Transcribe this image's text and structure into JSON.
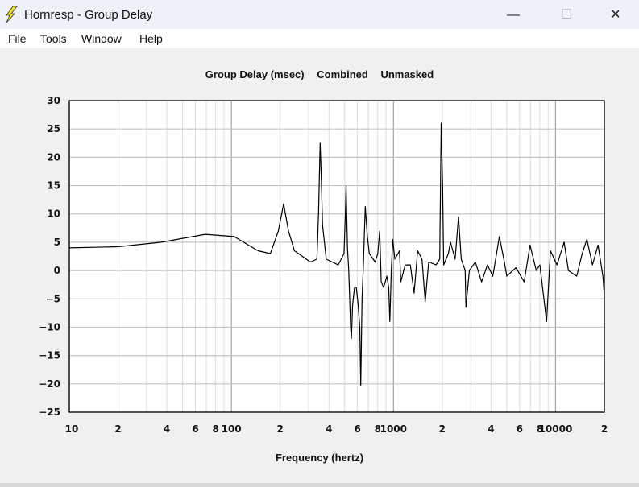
{
  "window": {
    "title": "Hornresp - Group Delay",
    "icon": "lightning-bolt-icon",
    "minimize": "—",
    "maximize": "☐",
    "close": "✕"
  },
  "menu": [
    "File",
    "Tools",
    "Window",
    "Help"
  ],
  "chart_header": [
    "Group Delay (msec)",
    "Combined",
    "Unmasked"
  ],
  "chart_data": {
    "type": "line",
    "title": "Group Delay (msec)   Combined   Unmasked",
    "xlabel": "Frequency (hertz)",
    "ylabel": "",
    "xscale": "log",
    "xlim": [
      10,
      20000
    ],
    "ylim": [
      -25,
      30
    ],
    "grid": true,
    "yticks": [
      30,
      25,
      20,
      15,
      10,
      5,
      0,
      -5,
      -10,
      -15,
      -20,
      -25
    ],
    "xtick_labels": [
      {
        "f": 10,
        "label": "10"
      },
      {
        "f": 20,
        "label": "2"
      },
      {
        "f": 40,
        "label": "4"
      },
      {
        "f": 60,
        "label": "6"
      },
      {
        "f": 80,
        "label": "8"
      },
      {
        "f": 100,
        "label": "100"
      },
      {
        "f": 200,
        "label": "2"
      },
      {
        "f": 400,
        "label": "4"
      },
      {
        "f": 600,
        "label": "6"
      },
      {
        "f": 800,
        "label": "8"
      },
      {
        "f": 1000,
        "label": "1000"
      },
      {
        "f": 2000,
        "label": "2"
      },
      {
        "f": 4000,
        "label": "4"
      },
      {
        "f": 6000,
        "label": "6"
      },
      {
        "f": 8000,
        "label": "8"
      },
      {
        "f": 10000,
        "label": "10000"
      },
      {
        "f": 20000,
        "label": "2"
      }
    ],
    "line_color": "#000000",
    "points": [
      [
        10,
        4.0
      ],
      [
        20,
        4.2
      ],
      [
        37,
        5.0
      ],
      [
        69,
        6.4
      ],
      [
        104,
        6.0
      ],
      [
        146,
        3.5
      ],
      [
        174,
        3.0
      ],
      [
        195,
        7
      ],
      [
        210,
        11.8
      ],
      [
        225,
        7
      ],
      [
        245,
        3.5
      ],
      [
        307,
        1.5
      ],
      [
        337,
        2
      ],
      [
        345,
        10
      ],
      [
        353,
        22.5
      ],
      [
        358,
        17
      ],
      [
        365,
        8
      ],
      [
        385,
        2
      ],
      [
        456,
        1
      ],
      [
        495,
        3
      ],
      [
        505,
        10
      ],
      [
        510,
        15
      ],
      [
        520,
        4
      ],
      [
        530,
        0
      ],
      [
        544,
        -10
      ],
      [
        550,
        -12
      ],
      [
        560,
        -6
      ],
      [
        575,
        -3
      ],
      [
        590,
        -3
      ],
      [
        605,
        -6
      ],
      [
        620,
        -10
      ],
      [
        628,
        -20.3
      ],
      [
        640,
        -5
      ],
      [
        650,
        0
      ],
      [
        670,
        11.3
      ],
      [
        690,
        6
      ],
      [
        710,
        3
      ],
      [
        770,
        1.5
      ],
      [
        800,
        3
      ],
      [
        822,
        7
      ],
      [
        840,
        -2
      ],
      [
        870,
        -3
      ],
      [
        910,
        -1
      ],
      [
        935,
        -3
      ],
      [
        950,
        -9
      ],
      [
        970,
        0
      ],
      [
        990,
        5.5
      ],
      [
        1020,
        2
      ],
      [
        1090,
        3.5
      ],
      [
        1110,
        -2
      ],
      [
        1180,
        1
      ],
      [
        1270,
        1
      ],
      [
        1340,
        -4
      ],
      [
        1410,
        3.5
      ],
      [
        1500,
        2
      ],
      [
        1570,
        -5.5
      ],
      [
        1650,
        1.5
      ],
      [
        1830,
        1
      ],
      [
        1930,
        2
      ],
      [
        1970,
        26
      ],
      [
        2010,
        15
      ],
      [
        2040,
        1
      ],
      [
        2180,
        3
      ],
      [
        2250,
        5
      ],
      [
        2400,
        2
      ],
      [
        2520,
        9.5
      ],
      [
        2620,
        2
      ],
      [
        2770,
        0
      ],
      [
        2800,
        -6.5
      ],
      [
        2940,
        0
      ],
      [
        3200,
        1.5
      ],
      [
        3500,
        -2
      ],
      [
        3800,
        1
      ],
      [
        4100,
        -1
      ],
      [
        4500,
        6
      ],
      [
        4800,
        2
      ],
      [
        5000,
        -1
      ],
      [
        5700,
        0.5
      ],
      [
        6400,
        -2
      ],
      [
        6960,
        4.5
      ],
      [
        7600,
        0
      ],
      [
        8000,
        1
      ],
      [
        8800,
        -9
      ],
      [
        9300,
        3.5
      ],
      [
        10200,
        1
      ],
      [
        11300,
        5
      ],
      [
        12000,
        0
      ],
      [
        13500,
        -1
      ],
      [
        14600,
        3
      ],
      [
        15600,
        5.5
      ],
      [
        16900,
        1
      ],
      [
        18300,
        4.5
      ],
      [
        19600,
        -1
      ],
      [
        20000,
        -4.5
      ]
    ]
  }
}
